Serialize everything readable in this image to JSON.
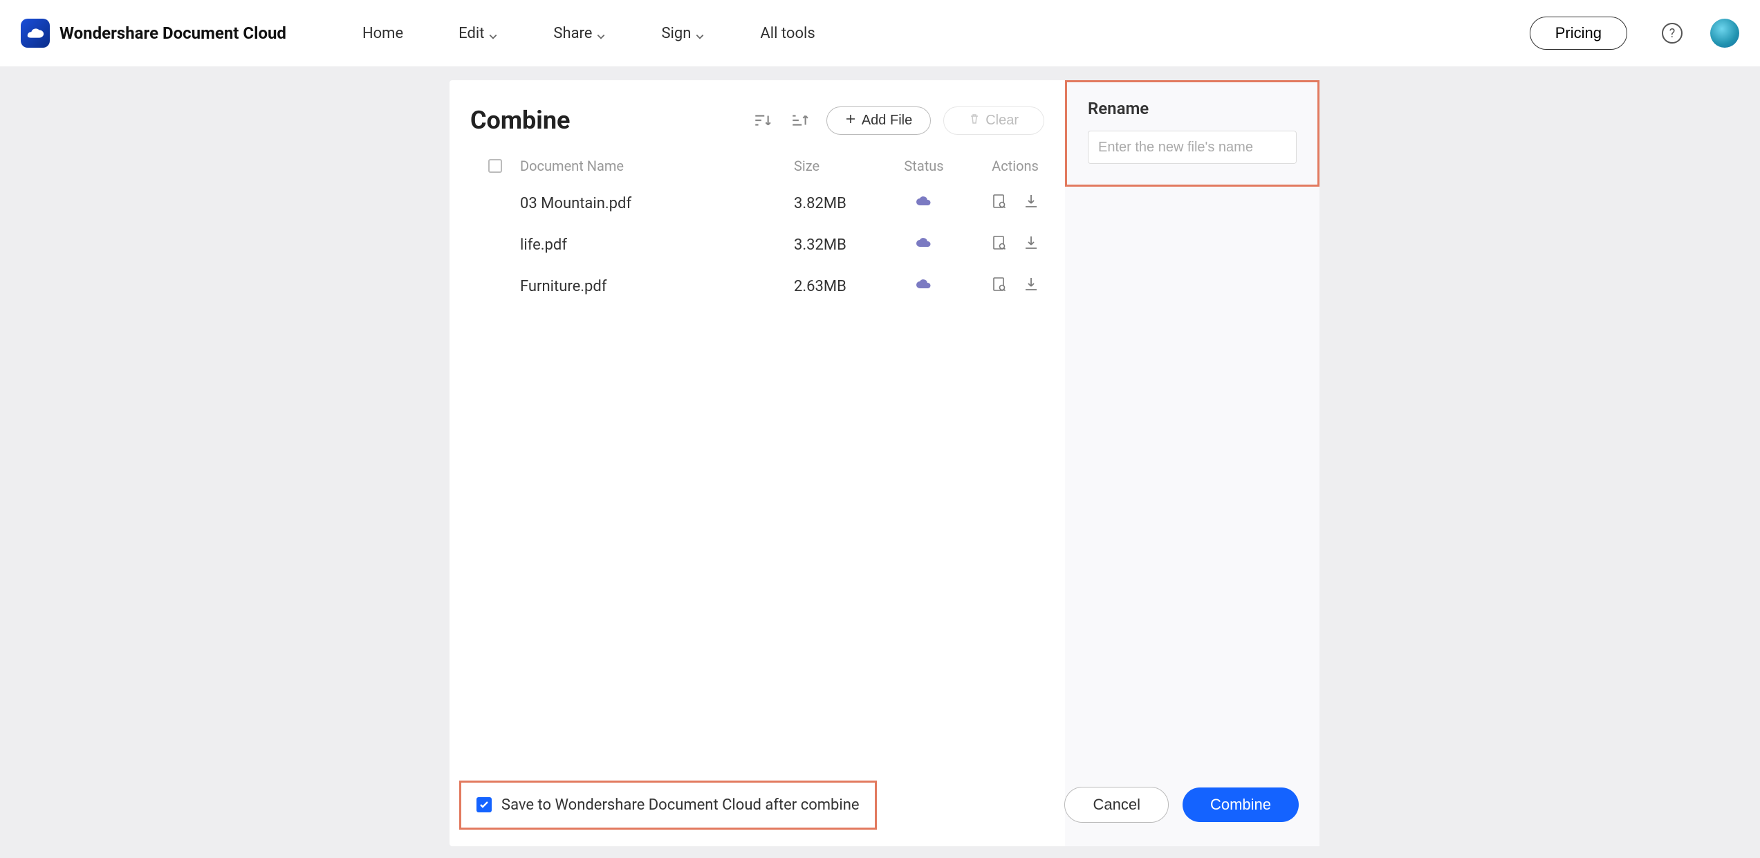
{
  "brand": "Wondershare Document Cloud",
  "nav": {
    "home": "Home",
    "edit": "Edit",
    "share": "Share",
    "sign": "Sign",
    "all_tools": "All tools"
  },
  "header_actions": {
    "pricing": "Pricing"
  },
  "page": {
    "title": "Combine",
    "add_file": "Add File",
    "clear": "Clear"
  },
  "table": {
    "headers": {
      "document_name": "Document Name",
      "size": "Size",
      "status": "Status",
      "actions": "Actions"
    },
    "rows": [
      {
        "name": "03 Mountain.pdf",
        "size": "3.82MB"
      },
      {
        "name": "life.pdf",
        "size": "3.32MB"
      },
      {
        "name": "Furniture.pdf",
        "size": "2.63MB"
      }
    ]
  },
  "rename": {
    "title": "Rename",
    "placeholder": "Enter the new file's name"
  },
  "footer": {
    "save_cloud_label": "Save to Wondershare Document Cloud after combine",
    "cancel": "Cancel",
    "combine": "Combine"
  },
  "colors": {
    "accent": "#1463ff",
    "highlight_border": "#e27a5f",
    "cloud_icon": "#7b7ac2"
  }
}
